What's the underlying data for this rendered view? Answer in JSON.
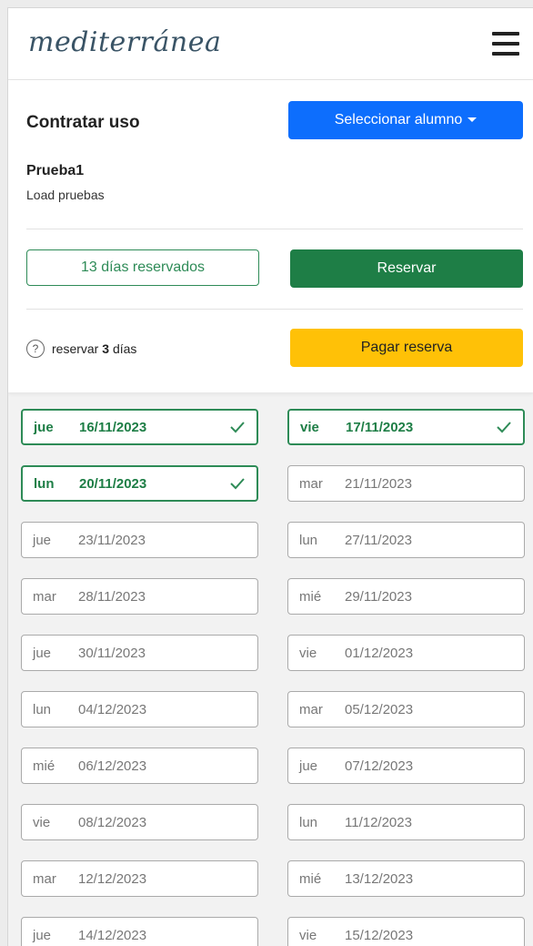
{
  "brand": {
    "logo_text": "mediterránea"
  },
  "panel": {
    "title": "Contratar uso",
    "select_student_label": "Seleccionar alumno",
    "student_name": "Prueba1",
    "student_subtitle": "Load pruebas",
    "reserved_days_label": "13 días reservados",
    "reserve_label": "Reservar",
    "help_prefix": "reservar ",
    "help_count": "3",
    "help_suffix": " días",
    "pay_label": "Pagar reserva"
  },
  "colors": {
    "primary": "#0d6efd",
    "success": "#1e7e46",
    "warning": "#ffc107",
    "selected_border": "#2e8b57"
  },
  "days": [
    {
      "dow": "jue",
      "date": "16/11/2023",
      "selected": true
    },
    {
      "dow": "vie",
      "date": "17/11/2023",
      "selected": true
    },
    {
      "dow": "lun",
      "date": "20/11/2023",
      "selected": true
    },
    {
      "dow": "mar",
      "date": "21/11/2023",
      "selected": false
    },
    {
      "dow": "jue",
      "date": "23/11/2023",
      "selected": false
    },
    {
      "dow": "lun",
      "date": "27/11/2023",
      "selected": false
    },
    {
      "dow": "mar",
      "date": "28/11/2023",
      "selected": false
    },
    {
      "dow": "mié",
      "date": "29/11/2023",
      "selected": false
    },
    {
      "dow": "jue",
      "date": "30/11/2023",
      "selected": false
    },
    {
      "dow": "vie",
      "date": "01/12/2023",
      "selected": false
    },
    {
      "dow": "lun",
      "date": "04/12/2023",
      "selected": false
    },
    {
      "dow": "mar",
      "date": "05/12/2023",
      "selected": false
    },
    {
      "dow": "mié",
      "date": "06/12/2023",
      "selected": false
    },
    {
      "dow": "jue",
      "date": "07/12/2023",
      "selected": false
    },
    {
      "dow": "vie",
      "date": "08/12/2023",
      "selected": false
    },
    {
      "dow": "lun",
      "date": "11/12/2023",
      "selected": false
    },
    {
      "dow": "mar",
      "date": "12/12/2023",
      "selected": false
    },
    {
      "dow": "mié",
      "date": "13/12/2023",
      "selected": false
    },
    {
      "dow": "jue",
      "date": "14/12/2023",
      "selected": false
    },
    {
      "dow": "vie",
      "date": "15/12/2023",
      "selected": false
    }
  ]
}
